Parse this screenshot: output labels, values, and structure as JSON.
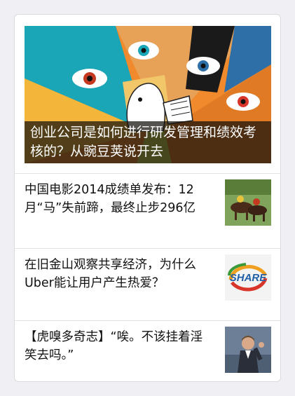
{
  "hero": {
    "title": "创业公司是如何进行研发管理和绩效考核的？从豌豆荚说开去",
    "image_icon": "eyes-illustration-icon"
  },
  "articles": [
    {
      "title": "中国电影2014成绩单发布：12月“马”失前蹄，最终止步296亿",
      "thumb_icon": "horse-racing-icon"
    },
    {
      "title": "在旧金山观察共享经济，为什么Uber能让用户产生热爱？",
      "thumb_icon": "share-logo-icon",
      "thumb_text": "SHARE"
    },
    {
      "title": "【虎嗅多奇志】“唉。不该挂着淫笑去吗。”",
      "thumb_icon": "man-in-suit-icon"
    }
  ],
  "colors": {
    "background": "#efeff4",
    "hero_orange": "#f08a2c",
    "accent_teal": "#1aa6b7",
    "accent_red": "#d9362b"
  }
}
